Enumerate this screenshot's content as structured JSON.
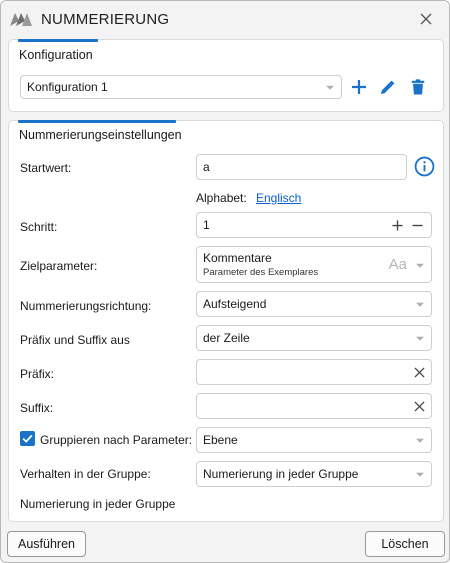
{
  "window": {
    "title": "NUMMERIERUNG"
  },
  "konfiguration": {
    "section_title": "Konfiguration",
    "selected": "Konfiguration 1"
  },
  "settings": {
    "section_title": "Nummerierungseinstellungen",
    "startwert_label": "Startwert:",
    "startwert_value": "a",
    "alphabet_label": "Alphabet:",
    "alphabet_link": "Englisch",
    "schritt_label": "Schritt:",
    "schritt_value": "1",
    "zielparameter_label": "Zielparameter:",
    "zielparameter_value": "Kommentare",
    "zielparameter_sub": "Parameter des Exemplares",
    "zielparameter_badge": "Aa",
    "richtung_label": "Nummerierungsrichtung:",
    "richtung_value": "Aufsteigend",
    "praefix_suffix_label": "Präfix und Suffix aus",
    "praefix_suffix_value": "der Zeile",
    "praefix_label": "Präfix:",
    "praefix_value": "",
    "suffix_label": "Suffix:",
    "suffix_value": "",
    "gruppieren_label": "Gruppieren nach Parameter:",
    "gruppieren_checked": true,
    "gruppieren_value": "Ebene",
    "verhalten_label": "Verhalten in der Gruppe:",
    "verhalten_value": "Numerierung in jeder Gruppe",
    "hint_text": "Numerierung in jeder Gruppe"
  },
  "footer": {
    "run_label": "Ausführen",
    "clear_label": "Löschen"
  },
  "colors": {
    "accent": "#1a73c8",
    "link": "#0b5ed7"
  }
}
